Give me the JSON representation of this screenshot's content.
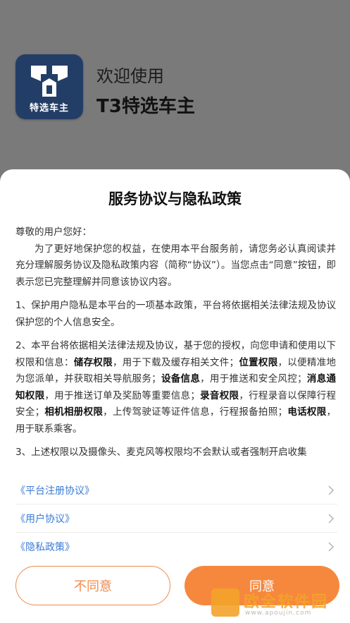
{
  "splash": {
    "logo_label": "特选车主",
    "welcome": "欢迎使用",
    "app_name": "T3特选车主"
  },
  "dialog": {
    "title": "服务协议与隐私政策",
    "greeting": "尊敬的用户您好：",
    "intro": "为了更好地保护您的权益，在使用本平台服务前，请您务必认真阅读并充分理解服务协议及隐私政策内容（简称“协议”）。当您点击“同意”按钮，即表示您已完整理解并同意该协议内容。",
    "item1": "1、保护用户隐私是本平台的一项基本政策，平台将依据相关法律法规及协议保护您的个人信息安全。",
    "item2": {
      "t1": "2、本平台将依据相关法律法规及协议，基于您的授权，向您申请和使用以下权限和信息：",
      "p1": "储存权限",
      "t2": "，用于下载及缓存相关文件；",
      "p2": "位置权限",
      "t3": "，以便精准地为您派单，并获取相关导航服务；",
      "p3": "设备信息",
      "t4": "，用于推送和安全风控；",
      "p4": "消息通知权限",
      "t5": "，用于推送订单及奖励等重要信息；",
      "p5": "录音权限",
      "t6": "，行程录音以保障行程安全；",
      "p6": "相机相册权限",
      "t7": "，上传驾驶证等证件信息，行程报备拍照；",
      "p7": "电话权限",
      "t8": "，用于联系乘客。"
    },
    "item3": "3、上述权限以及摄像头、麦克风等权限均不会默认或者强制开启收集",
    "links": [
      "《平台注册协议》",
      "《用户协议》",
      "《隐私政策》"
    ],
    "disagree_label": "不同意",
    "agree_label": "同意"
  },
  "watermark": {
    "text": "欧全软件园",
    "url": "www.apoujin.com"
  },
  "colors": {
    "accent": "#f6883e",
    "link": "#3a7bd5",
    "logo_bg": "#233e66"
  }
}
